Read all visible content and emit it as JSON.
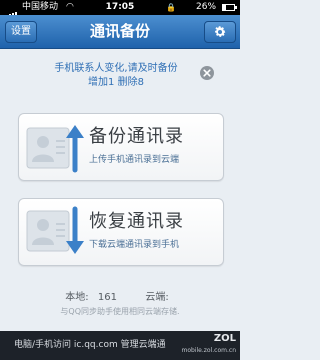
{
  "status_bar": {
    "carrier": "中国移动",
    "time": "17:05",
    "battery": "26%",
    "battery_level": 0.26
  },
  "nav": {
    "settings_label": "设置",
    "title": "通讯备份"
  },
  "notice": {
    "line1": "手机联系人变化,请及时备份",
    "line2": "增加1 删除8"
  },
  "backup": {
    "title": "备份通讯录",
    "subtitle": "上传手机通讯录到云端"
  },
  "restore": {
    "title": "恢复通讯录",
    "subtitle": "下载云端通讯录到手机"
  },
  "stats": {
    "local_label": "本地:",
    "local_count": "161",
    "cloud_label": "云端:",
    "cloud_count": ""
  },
  "hint": "与QQ同步助手使用相同云端存储.",
  "footer": {
    "text": "电脑/手机访问 ic.qq.com 管理云端通",
    "watermark_logo": "ZOL",
    "watermark_url": "mobile.zol.com.cn"
  },
  "colors": {
    "nav_top": "#4c8fd0",
    "nav_bottom": "#1f62ab",
    "accent_text": "#2f6fb5"
  }
}
